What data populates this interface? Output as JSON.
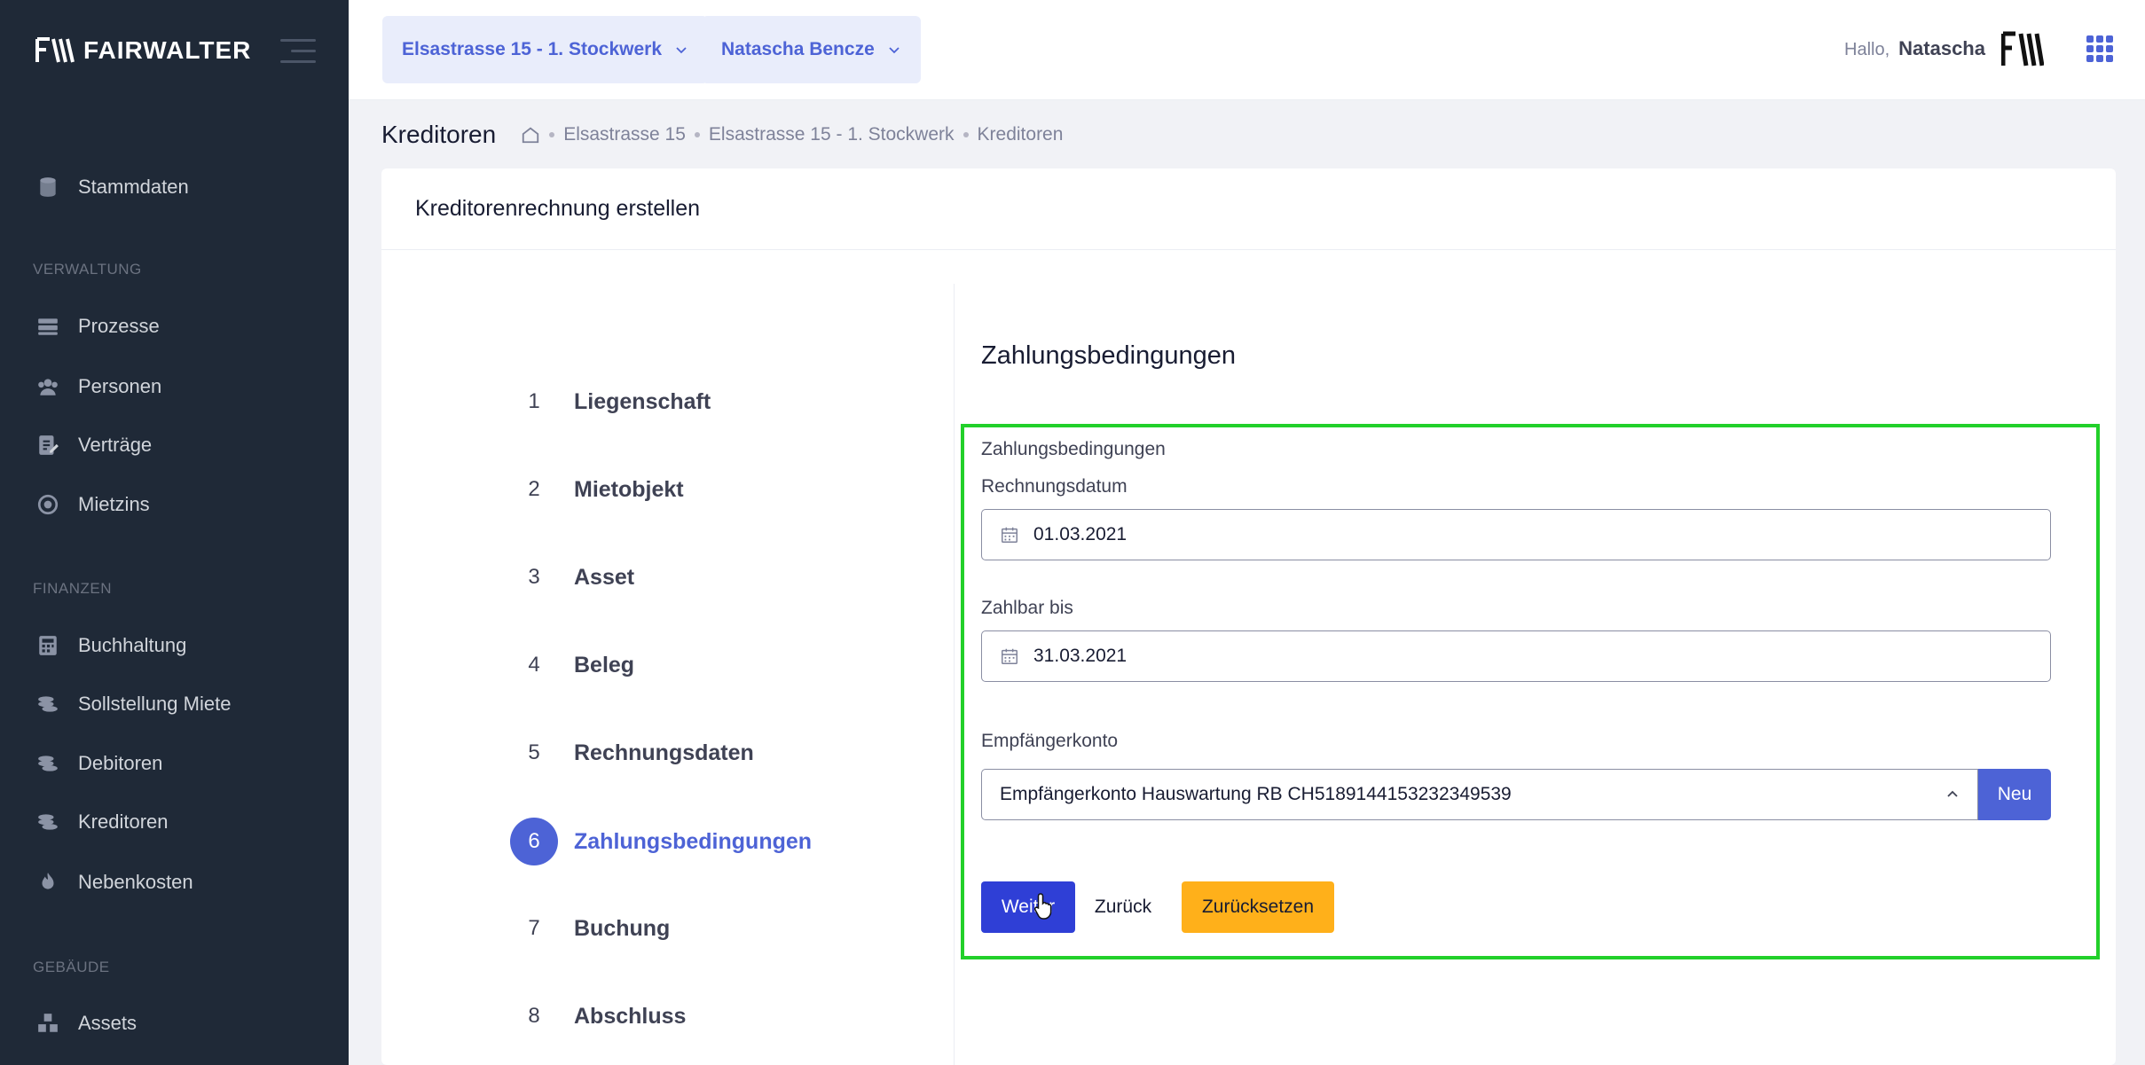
{
  "sidebar": {
    "logo_text": "FAIRWALTER",
    "items": [
      {
        "label": "Stammdaten",
        "icon": "database-icon"
      },
      {
        "section": "VERWALTUNG"
      },
      {
        "label": "Prozesse",
        "icon": "server-icon"
      },
      {
        "label": "Personen",
        "icon": "users-icon"
      },
      {
        "label": "Verträge",
        "icon": "contract-icon"
      },
      {
        "label": "Mietzins",
        "icon": "money-icon"
      },
      {
        "section": "FINANZEN"
      },
      {
        "label": "Buchhaltung",
        "icon": "calculator-icon"
      },
      {
        "label": "Sollstellung Miete",
        "icon": "coins-icon"
      },
      {
        "label": "Debitoren",
        "icon": "coins-icon"
      },
      {
        "label": "Kreditoren",
        "icon": "coins-icon"
      },
      {
        "label": "Nebenkosten",
        "icon": "fire-icon"
      },
      {
        "section": "GEBÄUDE"
      },
      {
        "label": "Assets",
        "icon": "cubes-icon"
      }
    ]
  },
  "header": {
    "property_selector": "Elsastrasse 15 - 1. Stockwerk",
    "user_selector": "Natascha Bencze",
    "greeting": "Hallo,",
    "user_name": "Natascha"
  },
  "subheader": {
    "title": "Kreditoren",
    "breadcrumb": [
      "Elsastrasse 15",
      "Elsastrasse 15 - 1. Stockwerk",
      "Kreditoren"
    ]
  },
  "card": {
    "title": "Kreditorenrechnung erstellen",
    "steps": [
      {
        "num": "1",
        "label": "Liegenschaft"
      },
      {
        "num": "2",
        "label": "Mietobjekt"
      },
      {
        "num": "3",
        "label": "Asset"
      },
      {
        "num": "4",
        "label": "Beleg"
      },
      {
        "num": "5",
        "label": "Rechnungsdaten"
      },
      {
        "num": "6",
        "label": "Zahlungsbedingungen"
      },
      {
        "num": "7",
        "label": "Buchung"
      },
      {
        "num": "8",
        "label": "Abschluss"
      }
    ],
    "active_step": 6
  },
  "form": {
    "section_title": "Zahlungsbedingungen",
    "group_label": "Zahlungsbedingungen",
    "invoice_date_label": "Rechnungsdatum",
    "invoice_date": "01.03.2021",
    "due_date_label": "Zahlbar bis",
    "due_date": "31.03.2021",
    "account_label": "Empfängerkonto",
    "account_value": "Empfängerkonto Hauswartung RB CH5189144153232349539",
    "new_button": "Neu",
    "next_button": "Weiter",
    "back_button": "Zurück",
    "reset_button": "Zurücksetzen"
  },
  "colors": {
    "accent": "#4d63d6",
    "sidebar_bg": "#1f2937",
    "highlight_border": "#22d02a",
    "warning": "#ffb01a"
  }
}
